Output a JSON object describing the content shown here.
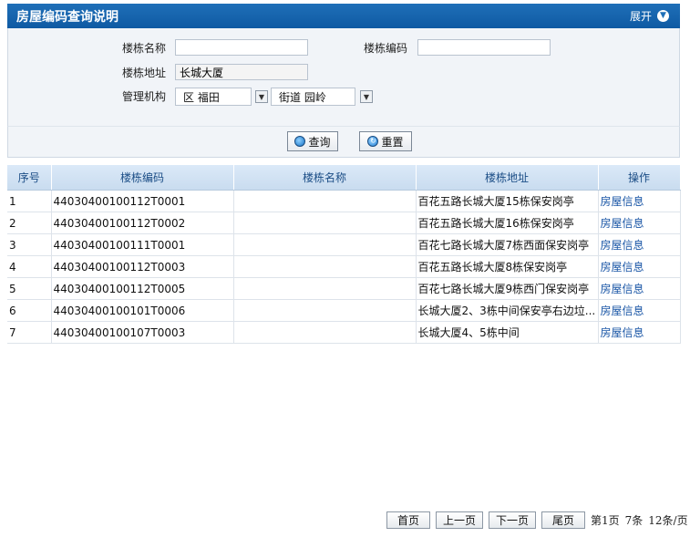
{
  "panel": {
    "title": "房屋编码查询说明",
    "expand_label": "展开"
  },
  "form": {
    "building_name_label": "楼栋名称",
    "building_name_value": "",
    "building_code_label": "楼栋编码",
    "building_code_value": "",
    "building_address_label": "楼栋地址",
    "building_address_value": "长城大厦",
    "org_label": "管理机构",
    "district_value": "区 福田",
    "street_value": "街道 园岭"
  },
  "buttons": {
    "search_label": "查询",
    "reset_label": "重置"
  },
  "table": {
    "headers": [
      "序号",
      "楼栋编码",
      "楼栋名称",
      "楼栋地址",
      "操作"
    ],
    "rows": [
      [
        "1",
        "44030400100112T0001",
        "",
        "百花五路长城大厦15栋保安岗亭",
        "房屋信息"
      ],
      [
        "2",
        "44030400100112T0002",
        "",
        "百花五路长城大厦16栋保安岗亭",
        "房屋信息"
      ],
      [
        "3",
        "44030400100111T0001",
        "",
        "百花七路长城大厦7栋西面保安岗亭",
        "房屋信息"
      ],
      [
        "4",
        "44030400100112T0003",
        "",
        "百花五路长城大厦8栋保安岗亭",
        "房屋信息"
      ],
      [
        "5",
        "44030400100112T0005",
        "",
        "百花七路长城大厦9栋西门保安岗亭",
        "房屋信息"
      ],
      [
        "6",
        "44030400100101T0006",
        "",
        "长城大厦2、3栋中间保安亭右边垃...",
        "房屋信息"
      ],
      [
        "7",
        "44030400100107T0003",
        "",
        "长城大厦4、5栋中间",
        "房屋信息"
      ]
    ]
  },
  "pager": {
    "first": "首页",
    "prev": "上一页",
    "next": "下一页",
    "last": "尾页",
    "page_info": "第1页",
    "count_info": "7条",
    "per_page_info": "12条/页"
  }
}
